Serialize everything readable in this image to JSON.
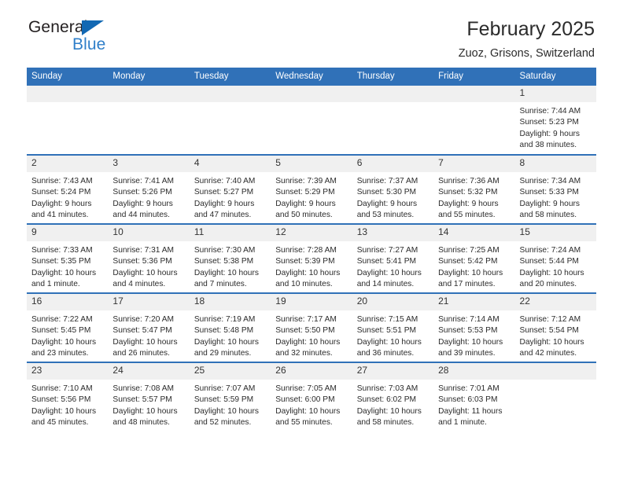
{
  "brand": {
    "name_part1": "General",
    "name_part2": "Blue",
    "accent_color": "#2f7fc9",
    "triangle_color": "#1268b3"
  },
  "header": {
    "title": "February 2025",
    "subtitle": "Zuoz, Grisons, Switzerland"
  },
  "theme": {
    "header_blue": "#3071b8",
    "daynum_band": "#f0f0f0",
    "text": "#2b2b2b"
  },
  "weekdays": [
    "Sunday",
    "Monday",
    "Tuesday",
    "Wednesday",
    "Thursday",
    "Friday",
    "Saturday"
  ],
  "labels": {
    "sunrise": "Sunrise:",
    "sunset": "Sunset:",
    "daylight": "Daylight:"
  },
  "weeks": [
    [
      {
        "empty": true
      },
      {
        "empty": true
      },
      {
        "empty": true
      },
      {
        "empty": true
      },
      {
        "empty": true
      },
      {
        "empty": true
      },
      {
        "day": "1",
        "sunrise": "Sunrise: 7:44 AM",
        "sunset": "Sunset: 5:23 PM",
        "daylight": "Daylight: 9 hours and 38 minutes."
      }
    ],
    [
      {
        "day": "2",
        "sunrise": "Sunrise: 7:43 AM",
        "sunset": "Sunset: 5:24 PM",
        "daylight": "Daylight: 9 hours and 41 minutes."
      },
      {
        "day": "3",
        "sunrise": "Sunrise: 7:41 AM",
        "sunset": "Sunset: 5:26 PM",
        "daylight": "Daylight: 9 hours and 44 minutes."
      },
      {
        "day": "4",
        "sunrise": "Sunrise: 7:40 AM",
        "sunset": "Sunset: 5:27 PM",
        "daylight": "Daylight: 9 hours and 47 minutes."
      },
      {
        "day": "5",
        "sunrise": "Sunrise: 7:39 AM",
        "sunset": "Sunset: 5:29 PM",
        "daylight": "Daylight: 9 hours and 50 minutes."
      },
      {
        "day": "6",
        "sunrise": "Sunrise: 7:37 AM",
        "sunset": "Sunset: 5:30 PM",
        "daylight": "Daylight: 9 hours and 53 minutes."
      },
      {
        "day": "7",
        "sunrise": "Sunrise: 7:36 AM",
        "sunset": "Sunset: 5:32 PM",
        "daylight": "Daylight: 9 hours and 55 minutes."
      },
      {
        "day": "8",
        "sunrise": "Sunrise: 7:34 AM",
        "sunset": "Sunset: 5:33 PM",
        "daylight": "Daylight: 9 hours and 58 minutes."
      }
    ],
    [
      {
        "day": "9",
        "sunrise": "Sunrise: 7:33 AM",
        "sunset": "Sunset: 5:35 PM",
        "daylight": "Daylight: 10 hours and 1 minute."
      },
      {
        "day": "10",
        "sunrise": "Sunrise: 7:31 AM",
        "sunset": "Sunset: 5:36 PM",
        "daylight": "Daylight: 10 hours and 4 minutes."
      },
      {
        "day": "11",
        "sunrise": "Sunrise: 7:30 AM",
        "sunset": "Sunset: 5:38 PM",
        "daylight": "Daylight: 10 hours and 7 minutes."
      },
      {
        "day": "12",
        "sunrise": "Sunrise: 7:28 AM",
        "sunset": "Sunset: 5:39 PM",
        "daylight": "Daylight: 10 hours and 10 minutes."
      },
      {
        "day": "13",
        "sunrise": "Sunrise: 7:27 AM",
        "sunset": "Sunset: 5:41 PM",
        "daylight": "Daylight: 10 hours and 14 minutes."
      },
      {
        "day": "14",
        "sunrise": "Sunrise: 7:25 AM",
        "sunset": "Sunset: 5:42 PM",
        "daylight": "Daylight: 10 hours and 17 minutes."
      },
      {
        "day": "15",
        "sunrise": "Sunrise: 7:24 AM",
        "sunset": "Sunset: 5:44 PM",
        "daylight": "Daylight: 10 hours and 20 minutes."
      }
    ],
    [
      {
        "day": "16",
        "sunrise": "Sunrise: 7:22 AM",
        "sunset": "Sunset: 5:45 PM",
        "daylight": "Daylight: 10 hours and 23 minutes."
      },
      {
        "day": "17",
        "sunrise": "Sunrise: 7:20 AM",
        "sunset": "Sunset: 5:47 PM",
        "daylight": "Daylight: 10 hours and 26 minutes."
      },
      {
        "day": "18",
        "sunrise": "Sunrise: 7:19 AM",
        "sunset": "Sunset: 5:48 PM",
        "daylight": "Daylight: 10 hours and 29 minutes."
      },
      {
        "day": "19",
        "sunrise": "Sunrise: 7:17 AM",
        "sunset": "Sunset: 5:50 PM",
        "daylight": "Daylight: 10 hours and 32 minutes."
      },
      {
        "day": "20",
        "sunrise": "Sunrise: 7:15 AM",
        "sunset": "Sunset: 5:51 PM",
        "daylight": "Daylight: 10 hours and 36 minutes."
      },
      {
        "day": "21",
        "sunrise": "Sunrise: 7:14 AM",
        "sunset": "Sunset: 5:53 PM",
        "daylight": "Daylight: 10 hours and 39 minutes."
      },
      {
        "day": "22",
        "sunrise": "Sunrise: 7:12 AM",
        "sunset": "Sunset: 5:54 PM",
        "daylight": "Daylight: 10 hours and 42 minutes."
      }
    ],
    [
      {
        "day": "23",
        "sunrise": "Sunrise: 7:10 AM",
        "sunset": "Sunset: 5:56 PM",
        "daylight": "Daylight: 10 hours and 45 minutes."
      },
      {
        "day": "24",
        "sunrise": "Sunrise: 7:08 AM",
        "sunset": "Sunset: 5:57 PM",
        "daylight": "Daylight: 10 hours and 48 minutes."
      },
      {
        "day": "25",
        "sunrise": "Sunrise: 7:07 AM",
        "sunset": "Sunset: 5:59 PM",
        "daylight": "Daylight: 10 hours and 52 minutes."
      },
      {
        "day": "26",
        "sunrise": "Sunrise: 7:05 AM",
        "sunset": "Sunset: 6:00 PM",
        "daylight": "Daylight: 10 hours and 55 minutes."
      },
      {
        "day": "27",
        "sunrise": "Sunrise: 7:03 AM",
        "sunset": "Sunset: 6:02 PM",
        "daylight": "Daylight: 10 hours and 58 minutes."
      },
      {
        "day": "28",
        "sunrise": "Sunrise: 7:01 AM",
        "sunset": "Sunset: 6:03 PM",
        "daylight": "Daylight: 11 hours and 1 minute."
      },
      {
        "empty": true
      }
    ]
  ]
}
